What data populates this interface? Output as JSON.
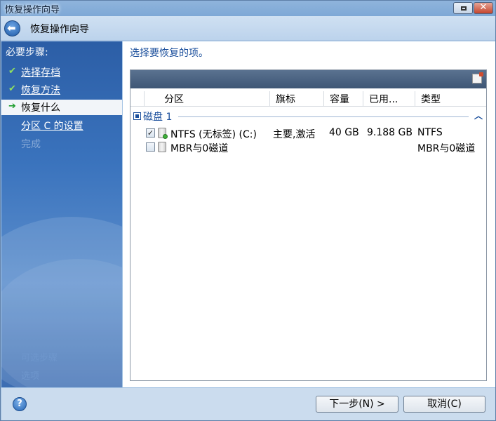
{
  "window": {
    "title": "恢复操作向导"
  },
  "nav": {
    "title": "恢复操作向导"
  },
  "sidebar": {
    "heading": "必要步骤:",
    "steps": [
      {
        "label": "选择存档",
        "state": "done"
      },
      {
        "label": "恢复方法",
        "state": "done"
      },
      {
        "label": "恢复什么",
        "state": "current"
      },
      {
        "label": "分区 C 的设置",
        "state": "pending"
      },
      {
        "label": "完成",
        "state": "disabled"
      }
    ],
    "optional": [
      "可选步骤",
      "选项"
    ]
  },
  "content": {
    "prompt": "选择要恢复的项。",
    "columns": [
      "分区",
      "旗标",
      "容量",
      "已用...",
      "类型"
    ],
    "group": {
      "name": "磁盘 1",
      "expanded": true
    },
    "rows": [
      {
        "checked": true,
        "name": "NTFS (无标签) (C:)",
        "flags": "主要,激活",
        "capacity": "40 GB",
        "used": "9.188 GB",
        "type": "NTFS",
        "icon": "partition-icon"
      },
      {
        "checked": false,
        "name": "MBR与0磁道",
        "flags": "",
        "capacity": "",
        "used": "",
        "type": "MBR与0磁道",
        "icon": "mbr-icon"
      }
    ]
  },
  "footer": {
    "next_label": "下一步(N) >",
    "cancel_label": "取消(C)"
  },
  "colors": {
    "accent": "#1b4f9c",
    "sidebar": "#3a73bd",
    "success": "#3fb03a"
  }
}
